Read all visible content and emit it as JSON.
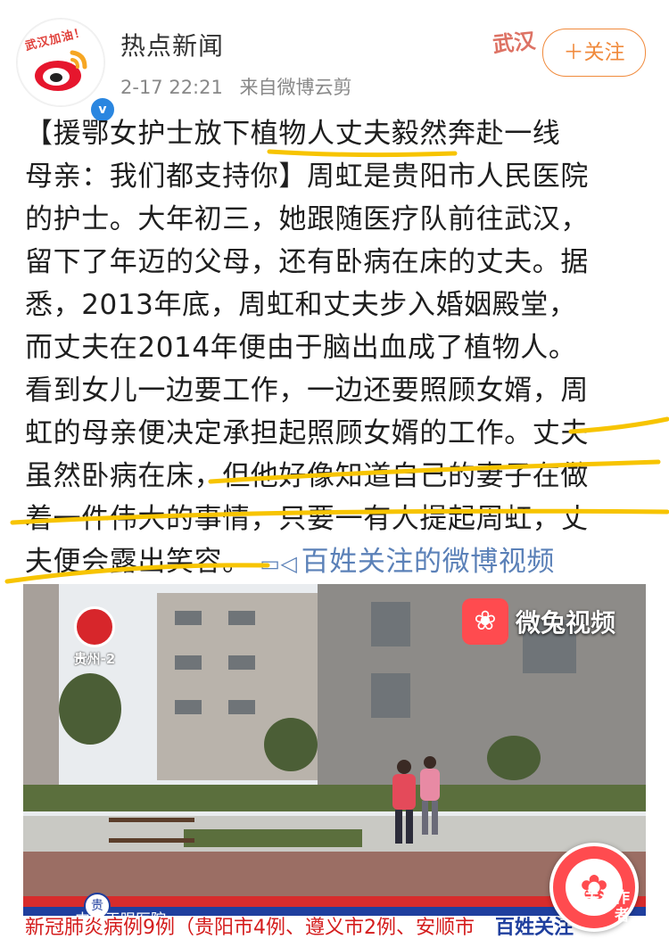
{
  "header": {
    "account_name": "热点新闻",
    "avatar_badge": "武汉加油！",
    "timestamp": "2-17 22:21",
    "source": "来自微博云剪",
    "decorative_text": "武汉",
    "follow_label": "＋关注"
  },
  "post": {
    "lines": [
      "【援鄂女护士放下植物人丈夫毅然奔赴一线",
      "母亲：我们都支持你】周虹是贵阳市人民医院",
      "的护士。大年初三，她跟随医疗队前往武汉，",
      "留下了年迈的父母，还有卧病在床的丈夫。据",
      "悉，2013年底，周虹和丈夫步入婚姻殿堂，",
      "而丈夫在2014年便由于脑出血成了植物人。",
      "看到女儿一边要工作，一边还要照顾女婿，周",
      "虹的母亲便决定承担起照顾女婿的工作。丈夫",
      "虽然卧病在床，但他好像知道自己的妻子在做",
      "着一件伟大的事情，只要一有人提起周虹，丈"
    ],
    "last_line_text": "夫便会露出笑容。",
    "video_link": "百姓关注的微博视频"
  },
  "video": {
    "channel_label": "贵州-2",
    "brand_label": "微兔视频",
    "ticker_header": "中国天眼医院",
    "ticker_text": "新冠肺炎病例9例（贵阳市4例、遵义市2例、安顺市",
    "ticker_badge": "贵",
    "follow_author_text": "关注作者",
    "program_label": "百姓关注"
  },
  "colors": {
    "accent_orange": "#f08a3c",
    "link_blue": "#5b81b8",
    "brand_red": "#ff4b4f",
    "underline_yellow": "#f7c400"
  }
}
